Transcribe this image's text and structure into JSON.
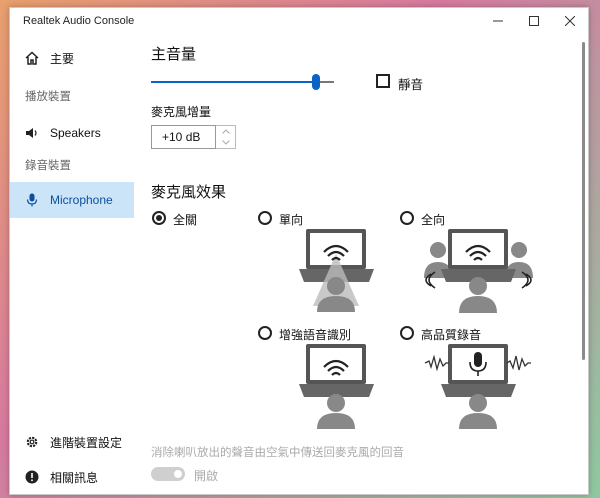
{
  "window": {
    "title": "Realtek Audio Console"
  },
  "sidebar": {
    "home_label": "主要",
    "playback_section": "播放裝置",
    "speakers_label": "Speakers",
    "record_section": "錄音裝置",
    "microphone_label": "Microphone",
    "advanced_label": "進階裝置設定",
    "info_label": "相關訊息"
  },
  "main": {
    "master_volume_title": "主音量",
    "master_volume_level": 0.9,
    "mute_label": "靜音",
    "mute_checked": false,
    "mic_boost_label": "麥克風增量",
    "mic_boost_value": "+10 dB",
    "mic_effect_title": "麥克風效果",
    "effects": [
      {
        "label": "全關",
        "selected": true
      },
      {
        "label": "單向",
        "selected": false
      },
      {
        "label": "全向",
        "selected": false
      },
      {
        "label": "增強語音識別",
        "selected": false
      },
      {
        "label": "高品質錄音",
        "selected": false
      }
    ],
    "echo_label": "消除喇叭放出的聲音由空氣中傳送回麥克風的回音",
    "echo_toggle_label": "開啟",
    "echo_toggle_on": false
  },
  "colors": {
    "accent": "#0a64c8",
    "selected_bg": "#cce4f7"
  }
}
